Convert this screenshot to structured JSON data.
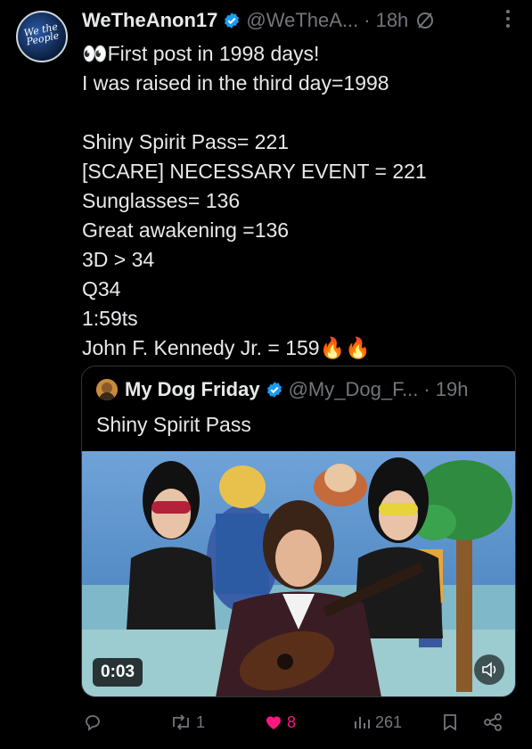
{
  "tweet": {
    "author_name": "WeTheAnon17",
    "author_handle": "@WeTheA...",
    "time_sep": "·",
    "time": "18h",
    "avatar_text": "We the People",
    "body_text": "👀First post in 1998 days!\nI was raised in the third day=1998\n\nShiny Spirit Pass= 221\n[SCARE] NECESSARY EVENT = 221\nSunglasses= 136\nGreat awakening =136\n3D > 34\nQ34\n1:59ts\nJohn F. Kennedy Jr. = 159🔥🔥"
  },
  "quote": {
    "author_name": "My Dog Friday",
    "author_handle": "@My_Dog_F...",
    "time_sep": "·",
    "time": "19h",
    "text": "Shiny Spirit Pass",
    "video_duration": "0:03"
  },
  "actions": {
    "reply_count": "",
    "retweet_count": "1",
    "like_count": "8",
    "view_count": "261"
  },
  "icons": [
    "verified-badge-icon",
    "no-entry-icon",
    "more-icon",
    "volume-icon",
    "reply-icon",
    "retweet-icon",
    "heart-icon",
    "views-icon",
    "bookmark-icon",
    "share-icon"
  ],
  "colors": {
    "background": "#000000",
    "text": "#e7e9ea",
    "muted": "#71767b",
    "verified": "#1d9bf0",
    "like": "#f91880"
  }
}
